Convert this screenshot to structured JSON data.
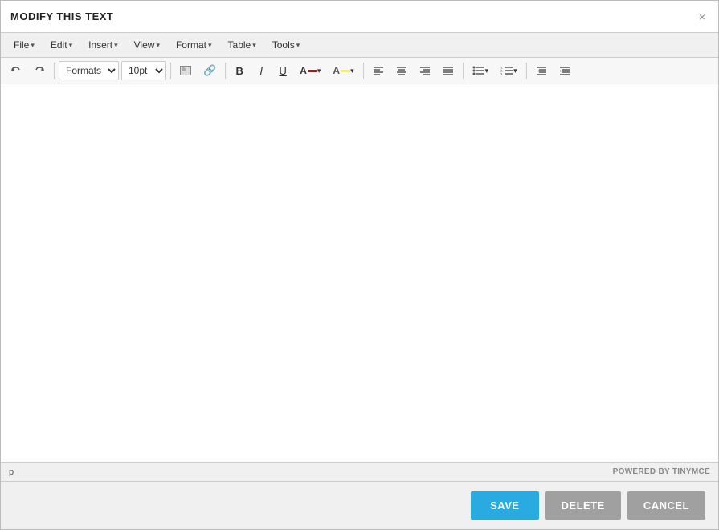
{
  "dialog": {
    "title": "MODIFY THIS TEXT",
    "close_label": "×"
  },
  "menu": {
    "items": [
      {
        "label": "File",
        "id": "file"
      },
      {
        "label": "Edit",
        "id": "edit"
      },
      {
        "label": "Insert",
        "id": "insert"
      },
      {
        "label": "View",
        "id": "view"
      },
      {
        "label": "Format",
        "id": "format"
      },
      {
        "label": "Table",
        "id": "table"
      },
      {
        "label": "Tools",
        "id": "tools"
      }
    ]
  },
  "toolbar": {
    "formats_label": "Formats",
    "fontsize_label": "10pt",
    "undo_label": "←",
    "redo_label": "→",
    "bold_label": "B",
    "italic_label": "I",
    "underline_label": "U"
  },
  "editor": {
    "content": ""
  },
  "statusbar": {
    "element": "p",
    "powered_by_prefix": "POWERED BY ",
    "powered_by_brand": "TINYMCE"
  },
  "footer": {
    "save_label": "SAVE",
    "delete_label": "DELETE",
    "cancel_label": "CANCEL"
  },
  "colors": {
    "save_bg": "#29abe2",
    "delete_bg": "#a0a0a0",
    "cancel_bg": "#a0a0a0"
  }
}
